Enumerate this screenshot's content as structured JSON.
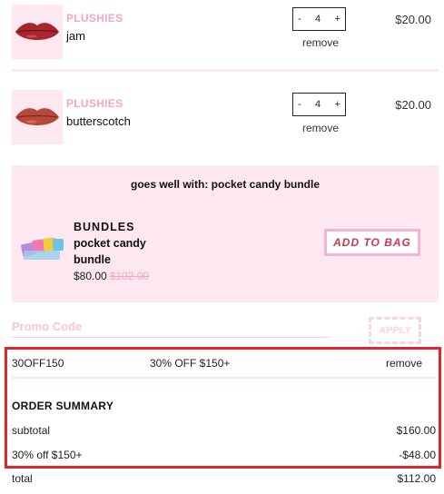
{
  "cart": {
    "items": [
      {
        "brand": "PLUSHIES",
        "name": "jam",
        "quantity": "4",
        "decrement": "-",
        "increment": "+",
        "remove": "remove",
        "price": "$20.00",
        "lip_color": "#a8252e"
      },
      {
        "brand": "PLUSHIES",
        "name": "butterscotch",
        "quantity": "4",
        "decrement": "-",
        "increment": "+",
        "remove": "remove",
        "price": "$20.00",
        "lip_color": "#b7483a"
      }
    ]
  },
  "upsell": {
    "title": "goes well with: pocket candy bundle",
    "brand": "BUNDLES",
    "name": "pocket candy bundle",
    "price": "$80.00",
    "original_price": "$102.00",
    "add_label": "ADD TO BAG"
  },
  "promo": {
    "label": "Promo Code",
    "apply_label": "APPLY",
    "applied_code": "30OFF150",
    "applied_desc": "30% OFF $150+",
    "remove_label": "remove"
  },
  "summary": {
    "title": "ORDER SUMMARY",
    "subtotal_label": "subtotal",
    "subtotal_value": "$160.00",
    "discount_label": "30% off $150+",
    "discount_value": "-$48.00",
    "total_label": "total",
    "total_value": "$112.00"
  },
  "colors": {
    "accent_pink": "#f2a6c8",
    "light_pink": "#fde7f0",
    "highlight_red": "#e0262c"
  }
}
